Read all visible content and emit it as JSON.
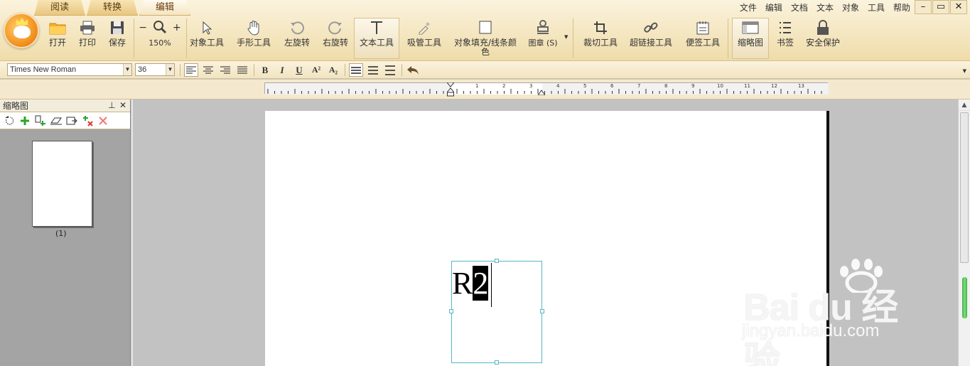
{
  "tabs": [
    {
      "label": "阅读",
      "active": false
    },
    {
      "label": "转换",
      "active": false
    },
    {
      "label": "编辑",
      "active": true
    }
  ],
  "menu": [
    "文件",
    "编辑",
    "文档",
    "文本",
    "对象",
    "工具",
    "帮助"
  ],
  "toolbar": {
    "open": "打开",
    "print": "打印",
    "save": "保存",
    "zoom": "150%",
    "object_tool": "对象工具",
    "hand_tool": "手形工具",
    "rotate_left": "左旋转",
    "rotate_right": "右旋转",
    "text_tool": "文本工具",
    "eyedropper_tool": "吸管工具",
    "fill_stroke_color_line1": "对象填充/线条颜",
    "fill_stroke_color_line2": "色",
    "stamp": "图章 (S)",
    "crop_tool": "裁切工具",
    "hyperlink_tool": "超链接工具",
    "note_tool": "便签工具",
    "thumbnails": "缩略图",
    "bookmarks": "书签",
    "security": "安全保护"
  },
  "format": {
    "font_family": "Times New Roman",
    "font_size": "36",
    "bold": "B",
    "italic": "I",
    "underline": "U",
    "superscript": "A²",
    "subscript": "A₂"
  },
  "ruler": {
    "left_numbers": [
      "1",
      "2",
      "3"
    ],
    "right_numbers": [
      "4",
      "5",
      "6",
      "7",
      "8",
      "9",
      "10",
      "11",
      "12",
      "13"
    ]
  },
  "thumbnail_panel": {
    "title": "缩略图",
    "pin": "ᵖ",
    "close": "✕",
    "page_label": "(1)"
  },
  "document": {
    "text_plain": "R",
    "text_selected": "2"
  },
  "watermark": {
    "brand": "Bai du 经验",
    "url": "jingyan.baidu.com"
  },
  "colors": {
    "toolbar_bg": "#f3e4bb",
    "textbox_border": "#53b8c0",
    "scroll_indicator": "#3fb044"
  }
}
